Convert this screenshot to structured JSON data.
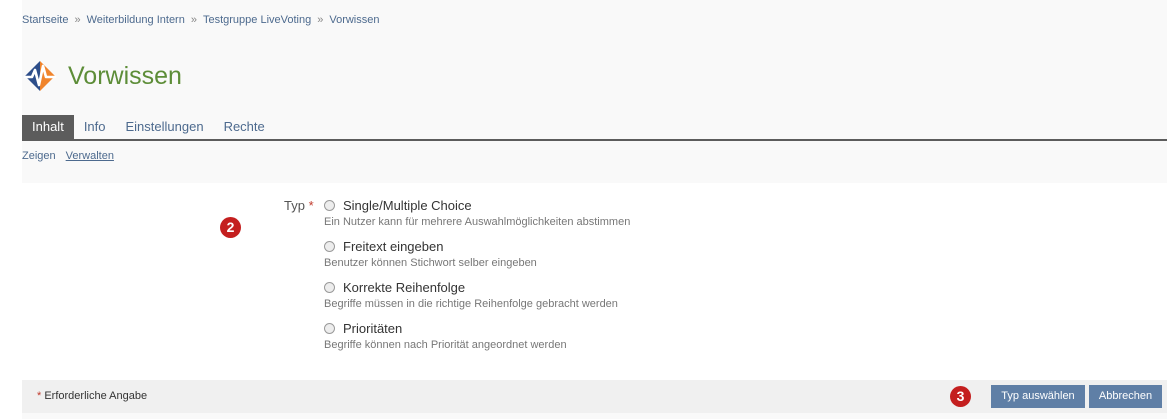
{
  "breadcrumb": {
    "items": [
      "Startseite",
      "Weiterbildung Intern",
      "Testgruppe LiveVoting",
      "Vorwissen"
    ],
    "separator": "»"
  },
  "page": {
    "title": "Vorwissen",
    "icon": "livevoting-icon"
  },
  "tabs": [
    {
      "label": "Inhalt",
      "active": true
    },
    {
      "label": "Info",
      "active": false
    },
    {
      "label": "Einstellungen",
      "active": false
    },
    {
      "label": "Rechte",
      "active": false
    }
  ],
  "subtabs": [
    {
      "label": "Zeigen",
      "active": false
    },
    {
      "label": "Verwalten",
      "active": true
    }
  ],
  "form": {
    "label": "Typ",
    "required_marker": "*",
    "badge_2": "2",
    "options": [
      {
        "label": "Single/Multiple Choice",
        "description": "Ein Nutzer kann für mehrere Auswahlmöglichkeiten abstimmen"
      },
      {
        "label": "Freitext eingeben",
        "description": "Benutzer können Stichwort selber eingeben"
      },
      {
        "label": "Korrekte Reihenfolge",
        "description": "Begriffe müssen in die richtige Reihenfolge gebracht werden"
      },
      {
        "label": "Prioritäten",
        "description": "Begriffe können nach Priorität angeordnet werden"
      }
    ]
  },
  "footer": {
    "required_marker": "*",
    "required_note": "Erforderliche Angabe",
    "badge_3": "3",
    "select_button": "Typ auswählen",
    "cancel_button": "Abbrechen"
  },
  "colors": {
    "title": "#5d8d38",
    "link": "#4d6a8e",
    "button": "#5f7fa6",
    "badge": "#c41f1f",
    "active_tab": "#5c5c5c"
  }
}
